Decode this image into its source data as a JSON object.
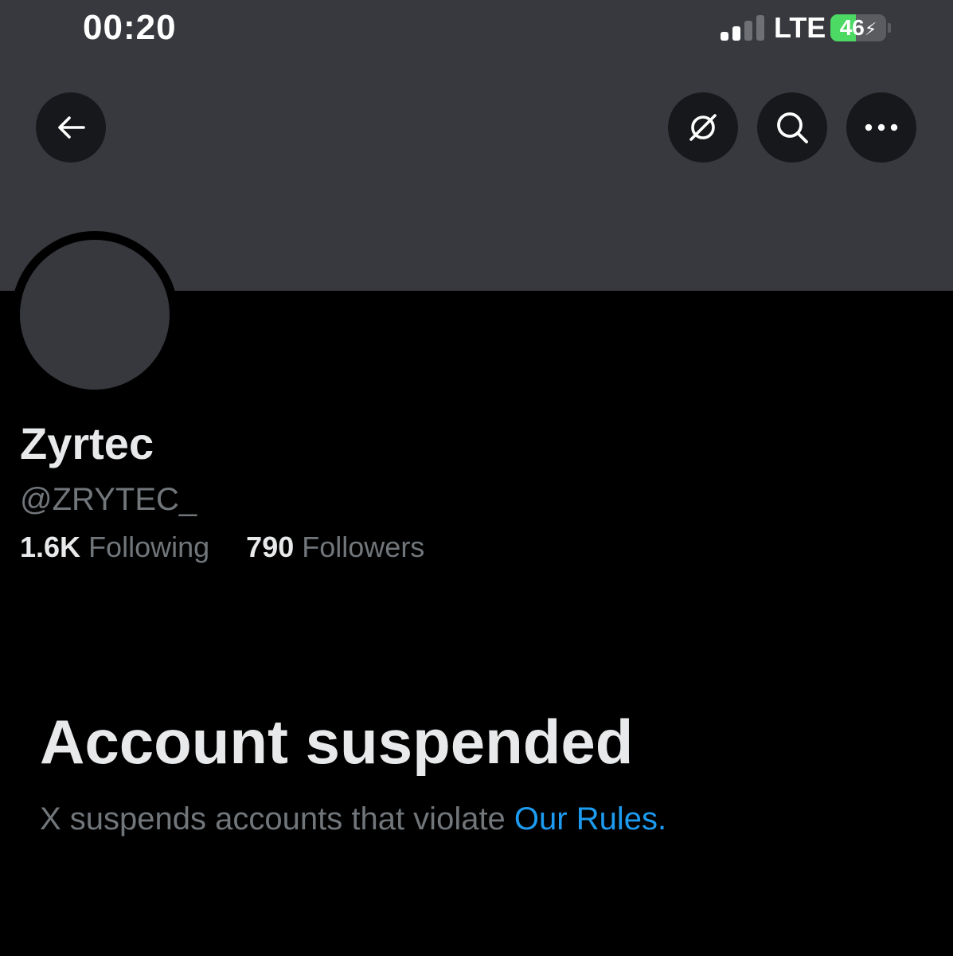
{
  "status_bar": {
    "time": "00:20",
    "network": "LTE",
    "battery": "46",
    "battery_level_percent": 46,
    "signal_bars_active": 2,
    "signal_bars_total": 4
  },
  "header": {
    "back_icon": "arrow-left-icon",
    "grok_icon": "grok-slash-circle-icon",
    "search_icon": "search-icon",
    "more_icon": "more-horizontal-icon"
  },
  "profile": {
    "display_name": "Zyrtec",
    "handle": "@ZRYTEC_",
    "following_count": "1.6K",
    "following_label": "Following",
    "followers_count": "790",
    "followers_label": "Followers"
  },
  "suspension": {
    "title": "Account suspended",
    "body_text": "X suspends accounts that violate ",
    "link_text": "Our Rules",
    "trailing": "."
  },
  "colors": {
    "banner": "#37393e",
    "background": "#000000",
    "primary_text": "#e7e9ea",
    "secondary_text": "#71767b",
    "link": "#1d9bf0",
    "battery_fill": "#4cd964"
  }
}
